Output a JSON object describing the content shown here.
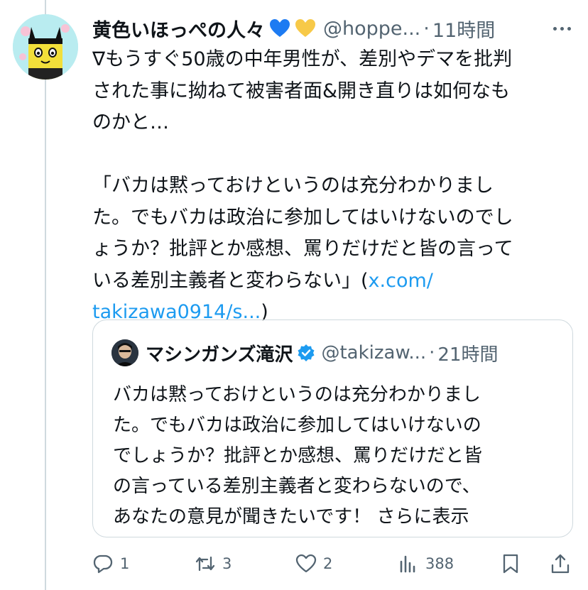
{
  "tweet": {
    "display_name": "黄色いほっぺの人々",
    "handle": "@hoppe...",
    "separator": "·",
    "time": "11時間",
    "body_lines": [
      "∇もうすぐ50歳の中年男性が、差別やデマを批判",
      "された事に拗ねて被害者面&開き直りは如何なも",
      "のかと…"
    ],
    "quote_lines": [
      "「バカは黙っておけというのは充分わかりまし",
      "た。でもバカは政治に参加してはいけないのでし",
      "ょうか？批評とか感想、罵りだけだと皆の言って"
    ],
    "quote_last_prefix": "いる差別主義者と変わらない」(",
    "link_part1": "x.com/",
    "link_part2": "takizawa0914/s...",
    "link_close": ")"
  },
  "quoted": {
    "display_name": "マシンガンズ滝沢",
    "handle": "@takizaw...",
    "separator": "·",
    "time": "21時間",
    "lines": [
      "バカは黙っておけというのは充分わかりまし",
      "た。でもバカは政治に参加してはいけないの",
      "でしょうか？批評とか感想、罵りだけだと皆",
      "の言っている差別主義者と変わらないので、"
    ],
    "last_line": "あなたの意見が聞きたいです！",
    "show_more": "さらに表示"
  },
  "actions": {
    "reply_count": "1",
    "repost_count": "3",
    "like_count": "2",
    "view_count": "388"
  },
  "icons": {
    "blue_heart": "blue-heart-emoji",
    "yellow_heart": "yellow-heart-emoji",
    "verified": "verified-badge-icon",
    "more": "more-icon",
    "reply": "reply-icon",
    "repost": "repost-icon",
    "like": "like-icon",
    "views": "views-icon",
    "bookmark": "bookmark-icon",
    "share": "share-icon"
  },
  "colors": {
    "text": "#0f1419",
    "secondary": "#536471",
    "link": "#1d9bf0",
    "border": "#cfd9de",
    "blue_heart": "#1d7bf2",
    "yellow_heart": "#f7c948"
  }
}
